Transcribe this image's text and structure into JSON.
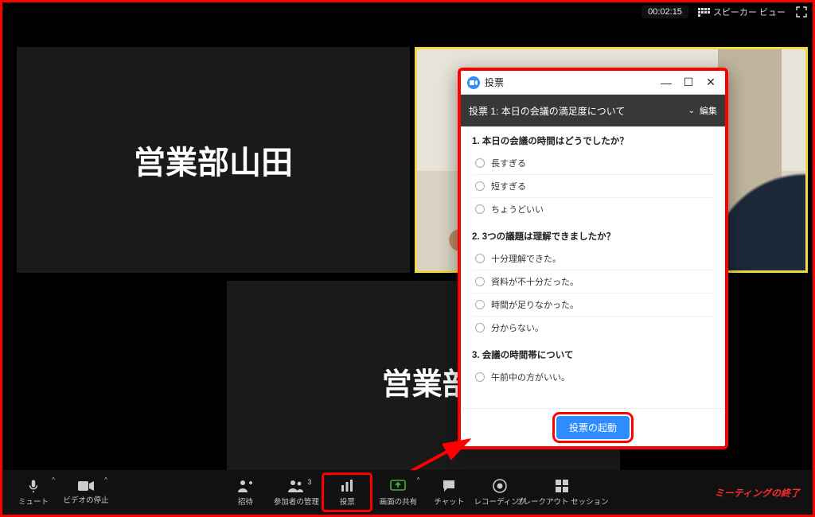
{
  "topbar": {
    "timer": "00:02:15",
    "speaker_view": "スピーカー ビュー"
  },
  "tiles": {
    "participant1": "営業部山田",
    "participant2": "営業部鈴:"
  },
  "poll": {
    "window_title": "投票",
    "header_prefix": "投票 1:",
    "header_name": "本日の会議の満足度について",
    "edit": "編集",
    "questions": [
      {
        "title": "1. 本日の会議の時間はどうでしたか？",
        "options": [
          "長すぎる",
          "短すぎる",
          "ちょうどいい"
        ]
      },
      {
        "title": "2. 3つの議題は理解できましたか？",
        "options": [
          "十分理解できた。",
          "資料が不十分だった。",
          "時間が足りなかった。",
          "分からない。"
        ]
      },
      {
        "title": "3. 会議の時間帯について",
        "options": [
          "午前中の方がいい。"
        ]
      }
    ],
    "launch_label": "投票の起動"
  },
  "toolbar": {
    "mute": "ミュート",
    "stop_video": "ビデオの停止",
    "invite": "招待",
    "manage": "参加者の管理",
    "manage_count": "3",
    "polls": "投票",
    "share": "画面の共有",
    "chat": "チャット",
    "record": "レコーディング",
    "breakout": "ブレークアウト セッション",
    "end": "ミーティングの終了"
  }
}
